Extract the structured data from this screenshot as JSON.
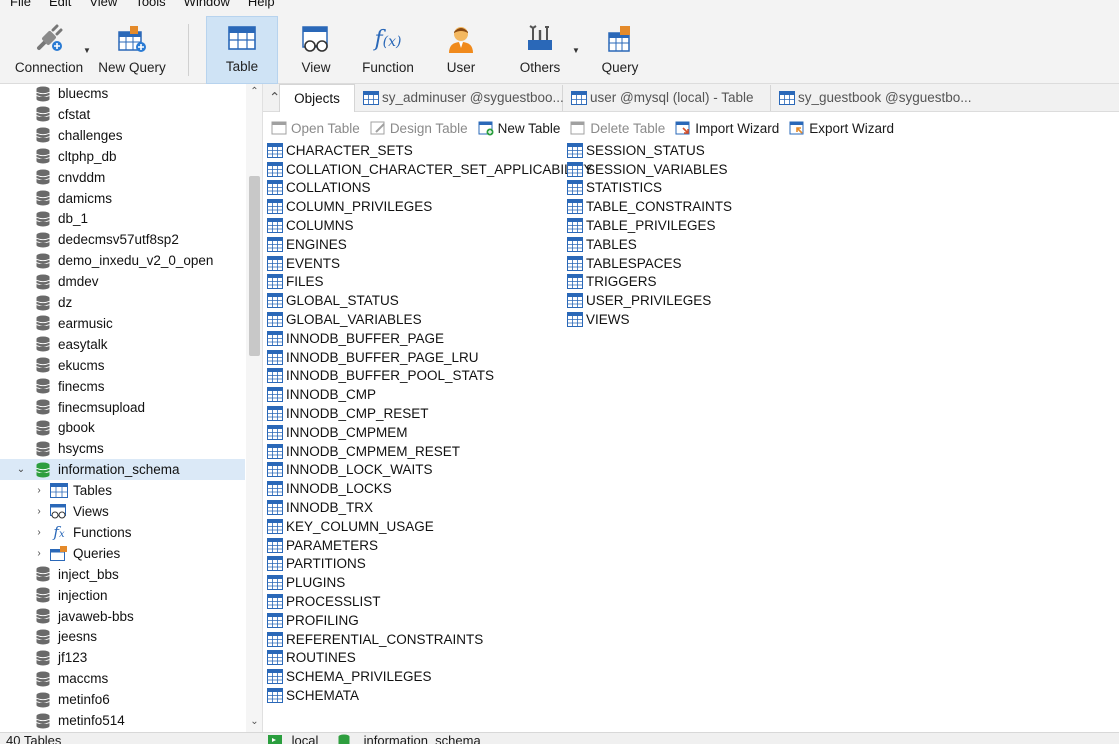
{
  "menu": [
    "File",
    "Edit",
    "View",
    "Tools",
    "Window",
    "Help"
  ],
  "toolbar": {
    "connection": "Connection",
    "new_query": "New Query",
    "table": "Table",
    "view": "View",
    "function": "Function",
    "user": "User",
    "others": "Others",
    "query": "Query"
  },
  "sidebar": {
    "databases_before": [
      "bluecms",
      "cfstat",
      "challenges",
      "cltphp_db",
      "cnvddm",
      "damicms",
      "db_1",
      "dedecmsv57utf8sp2",
      "demo_inxedu_v2_0_open",
      "dmdev",
      "dz",
      "earmusic",
      "easytalk",
      "ekucms",
      "finecms",
      "finecmsupload",
      "gbook",
      "hsycms"
    ],
    "selected_db": "information_schema",
    "children": [
      "Tables",
      "Views",
      "Functions",
      "Queries"
    ],
    "databases_after": [
      "inject_bbs",
      "injection",
      "javaweb-bbs",
      "jeesns",
      "jf123",
      "maccms",
      "metinfo6",
      "metinfo514"
    ]
  },
  "tabs": [
    "Objects",
    "sy_adminuser @syguestboo...",
    "user @mysql (local) - Table",
    "sy_guestbook @syguestbo..."
  ],
  "objbar": {
    "open_table": "Open Table",
    "design_table": "Design Table",
    "new_table": "New Table",
    "delete_table": "Delete Table",
    "import_wizard": "Import Wizard",
    "export_wizard": "Export Wizard"
  },
  "tables_col1": [
    "CHARACTER_SETS",
    "COLLATION_CHARACTER_SET_APPLICABILITY",
    "COLLATIONS",
    "COLUMN_PRIVILEGES",
    "COLUMNS",
    "ENGINES",
    "EVENTS",
    "FILES",
    "GLOBAL_STATUS",
    "GLOBAL_VARIABLES",
    "INNODB_BUFFER_PAGE",
    "INNODB_BUFFER_PAGE_LRU",
    "INNODB_BUFFER_POOL_STATS",
    "INNODB_CMP",
    "INNODB_CMP_RESET",
    "INNODB_CMPMEM",
    "INNODB_CMPMEM_RESET",
    "INNODB_LOCK_WAITS",
    "INNODB_LOCKS",
    "INNODB_TRX",
    "KEY_COLUMN_USAGE",
    "PARAMETERS",
    "PARTITIONS",
    "PLUGINS",
    "PROCESSLIST",
    "PROFILING",
    "REFERENTIAL_CONSTRAINTS",
    "ROUTINES",
    "SCHEMA_PRIVILEGES",
    "SCHEMATA"
  ],
  "tables_col2": [
    "SESSION_STATUS",
    "SESSION_VARIABLES",
    "STATISTICS",
    "TABLE_CONSTRAINTS",
    "TABLE_PRIVILEGES",
    "TABLES",
    "TABLESPACES",
    "TRIGGERS",
    "USER_PRIVILEGES",
    "VIEWS"
  ],
  "status": {
    "count": "40 Tables",
    "connection": "local",
    "database": "information_schema"
  },
  "colors": {
    "selected_bg": "#dbe9f7",
    "active_tool_bg": "#cfe3f5",
    "db_green": "#2e9e3e"
  }
}
